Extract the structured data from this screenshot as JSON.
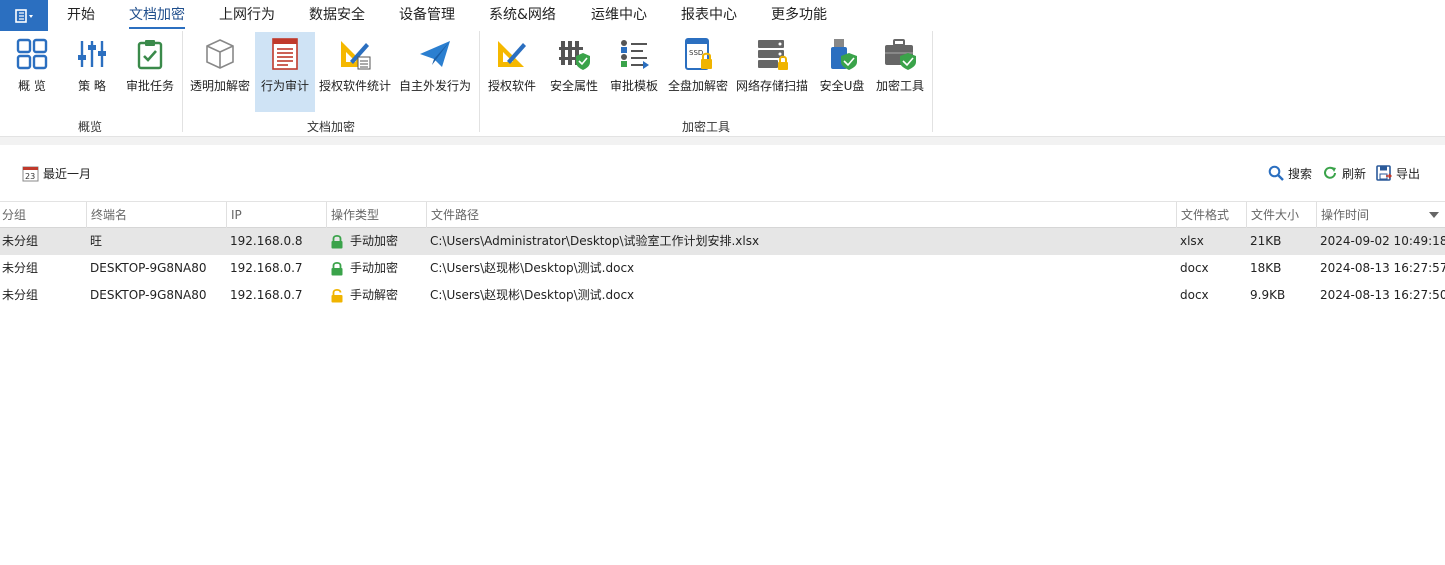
{
  "menu": {
    "items": [
      {
        "label": "开始",
        "active": false
      },
      {
        "label": "文档加密",
        "active": true
      },
      {
        "label": "上网行为",
        "active": false
      },
      {
        "label": "数据安全",
        "active": false
      },
      {
        "label": "设备管理",
        "active": false
      },
      {
        "label": "系统&网络",
        "active": false
      },
      {
        "label": "运维中心",
        "active": false
      },
      {
        "label": "报表中心",
        "active": false
      },
      {
        "label": "更多功能",
        "active": false
      }
    ]
  },
  "ribbon": {
    "buttons": [
      {
        "label": "概 览",
        "icon": "overview-grid-icon"
      },
      {
        "label": "策 略",
        "icon": "policy-sliders-icon"
      },
      {
        "label": "审批任务",
        "icon": "approval-clipboard-icon"
      },
      {
        "label": "透明加解密",
        "icon": "transparent-cube-icon"
      },
      {
        "label": "行为审计",
        "icon": "behavior-audit-icon",
        "active": true
      },
      {
        "label": "授权软件统计",
        "icon": "authorized-software-stats-icon"
      },
      {
        "label": "自主外发行为",
        "icon": "paper-plane-icon"
      },
      {
        "label": "授权软件",
        "icon": "authorized-software-icon"
      },
      {
        "label": "安全属性",
        "icon": "security-attribute-icon"
      },
      {
        "label": "审批模板",
        "icon": "approval-template-icon"
      },
      {
        "label": "全盘加解密",
        "icon": "ssd-lock-icon"
      },
      {
        "label": "网络存储扫描",
        "icon": "network-storage-icon"
      },
      {
        "label": "安全U盘",
        "icon": "usb-shield-icon"
      },
      {
        "label": "加密工具",
        "icon": "toolbox-shield-icon"
      }
    ],
    "groups": [
      "概览",
      "文档加密",
      "加密工具"
    ]
  },
  "toolbar": {
    "date_icon_text": "23",
    "date_range": "最近一月",
    "search": "搜索",
    "refresh": "刷新",
    "export": "导出"
  },
  "table": {
    "columns": [
      "分组",
      "终端名",
      "IP",
      "操作类型",
      "文件路径",
      "文件格式",
      "文件大小",
      "操作时间"
    ],
    "rows": [
      {
        "group": "未分组",
        "terminal": "旺",
        "ip": "192.168.0.8",
        "op": "手动加密",
        "lock": "locked",
        "path": "C:\\Users\\Administrator\\Desktop\\试验室工作计划安排.xlsx",
        "format": "xlsx",
        "size": "21KB",
        "time": "2024-09-02 10:49:18",
        "selected": true
      },
      {
        "group": "未分组",
        "terminal": "DESKTOP-9G8NA80",
        "ip": "192.168.0.7",
        "op": "手动加密",
        "lock": "locked",
        "path": "C:\\Users\\赵现彬\\Desktop\\测试.docx",
        "format": "docx",
        "size": "18KB",
        "time": "2024-08-13 16:27:57",
        "selected": false
      },
      {
        "group": "未分组",
        "terminal": "DESKTOP-9G8NA80",
        "ip": "192.168.0.7",
        "op": "手动解密",
        "lock": "unlocked",
        "path": "C:\\Users\\赵现彬\\Desktop\\测试.docx",
        "format": "docx",
        "size": "9.9KB",
        "time": "2024-08-13 16:27:50",
        "selected": false
      }
    ]
  },
  "colors": {
    "accent": "#2b6fc0",
    "selected_button": "#cfe3f5",
    "selected_row": "#e6e6e6",
    "lock_green": "#3aa34a",
    "lock_yellow": "#f0b400"
  }
}
